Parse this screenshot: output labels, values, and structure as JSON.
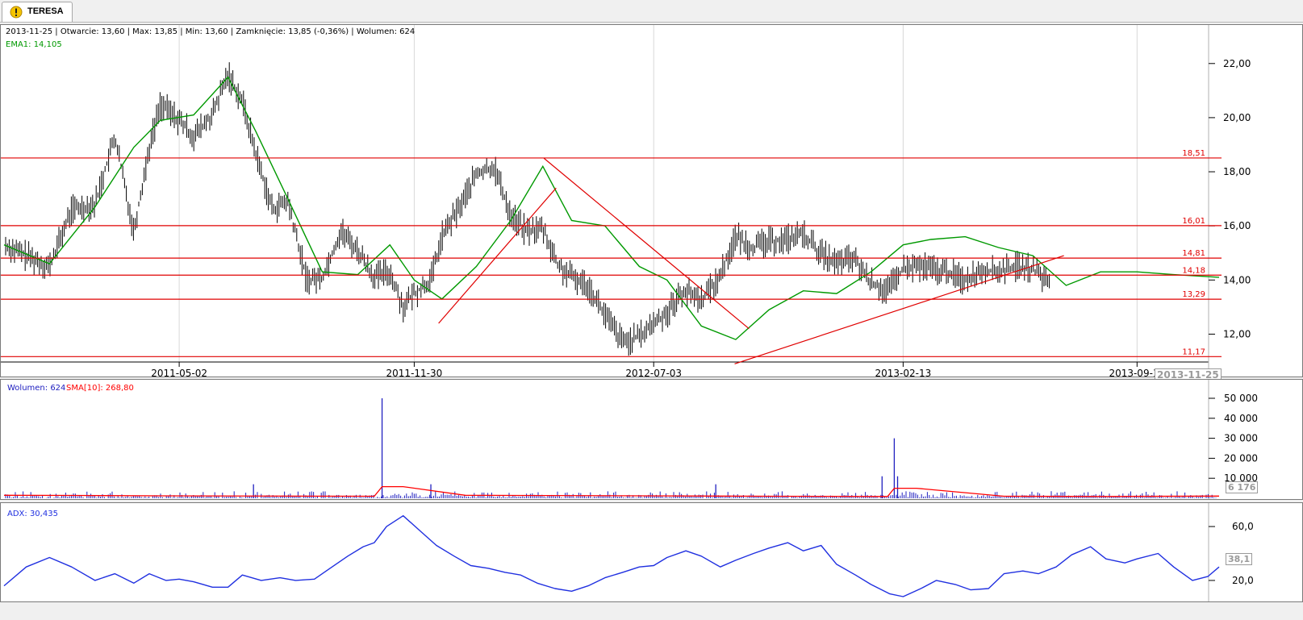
{
  "tab": {
    "label": "TERESA",
    "icon": "warning-icon"
  },
  "price_panel": {
    "info_line": "2013-11-25 | Otwarcie: 13,60 | Max: 13,85 | Min: 13,60 | Zamknięcie: 13,85 (-0,36%)  | Wolumen: 624",
    "ema_label": "EMA1: 14,105",
    "current_date_badge": "2013-11-25"
  },
  "volume_panel": {
    "volume_label": "Wolumen: 624",
    "sma_label": "SMA[10]: 268,80",
    "last_value_badge": "6 176"
  },
  "adx_panel": {
    "adx_label": "ADX: 30,435",
    "last_value_badge": "38,1"
  },
  "colors": {
    "ohlc": "#000000",
    "ema": "#009900",
    "levels": "#e00000",
    "volume": "#2020c0",
    "sma": "#ff0000",
    "adx": "#2030e0"
  },
  "chart_data": [
    {
      "type": "ohlc",
      "title": "TERESA",
      "x_tick_labels": [
        "2011-05-02",
        "2011-11-30",
        "2012-07-03",
        "2013-02-13",
        "2013-09-12"
      ],
      "y_tick_labels": [
        "12,00",
        "14,00",
        "16,00",
        "18,00",
        "20,00",
        "22,00"
      ],
      "ylim": [
        11.0,
        22.5
      ],
      "horizontal_levels": [
        {
          "label": "18,51",
          "value": 18.51
        },
        {
          "label": "16,01",
          "value": 16.01
        },
        {
          "label": "14,81",
          "value": 14.81
        },
        {
          "label": "14,18",
          "value": 14.18
        },
        {
          "label": "13,29",
          "value": 13.29
        },
        {
          "label": "11,17",
          "value": 11.17
        }
      ],
      "trend_lines": [
        {
          "from": [
            "2011-12-22",
            12.4
          ],
          "to": [
            "2012-04-06",
            17.4
          ]
        },
        {
          "from": [
            "2012-03-26",
            18.5
          ],
          "to": [
            "2012-09-27",
            12.2
          ]
        },
        {
          "from": [
            "2012-09-14",
            10.9
          ],
          "to": [
            "2013-07-08",
            14.9
          ]
        }
      ],
      "close_series": {
        "name": "close",
        "x": [
          "2010-11-25",
          "2010-12-15",
          "2011-01-05",
          "2011-01-25",
          "2011-02-15",
          "2011-03-05",
          "2011-03-22",
          "2011-04-05",
          "2011-04-15",
          "2011-05-02",
          "2011-05-15",
          "2011-06-01",
          "2011-06-15",
          "2011-06-28",
          "2011-07-10",
          "2011-07-25",
          "2011-08-08",
          "2011-08-25",
          "2011-09-08",
          "2011-09-25",
          "2011-10-10",
          "2011-10-25",
          "2011-11-08",
          "2011-11-20",
          "2011-11-30",
          "2011-12-15",
          "2011-12-25",
          "2012-01-10",
          "2012-01-25",
          "2012-02-10",
          "2012-02-25",
          "2012-03-10",
          "2012-03-25",
          "2012-04-08",
          "2012-04-20",
          "2012-05-05",
          "2012-05-20",
          "2012-06-05",
          "2012-06-20",
          "2012-07-03",
          "2012-07-15",
          "2012-07-30",
          "2012-08-15",
          "2012-08-30",
          "2012-09-15",
          "2012-09-30",
          "2012-10-15",
          "2012-10-30",
          "2012-11-15",
          "2012-11-30",
          "2012-12-15",
          "2012-12-30",
          "2013-01-15",
          "2013-01-30",
          "2013-02-13",
          "2013-02-25",
          "2013-03-10",
          "2013-03-25",
          "2013-04-10",
          "2013-04-25",
          "2013-05-10",
          "2013-05-25",
          "2013-06-10",
          "2013-06-25",
          "2013-07-10",
          "2013-07-25",
          "2013-08-10",
          "2013-08-25",
          "2013-09-12",
          "2013-09-30",
          "2013-10-15",
          "2013-10-30",
          "2013-11-15",
          "2013-11-25"
        ],
        "y": [
          15.3,
          14.9,
          14.5,
          16.6,
          16.8,
          19.3,
          15.8,
          18.9,
          20.5,
          19.9,
          19.3,
          20.1,
          21.6,
          20.6,
          18.7,
          16.6,
          16.9,
          14.0,
          14.1,
          15.8,
          15.1,
          14.1,
          14.3,
          13.0,
          13.5,
          14.0,
          15.6,
          16.7,
          17.9,
          18.2,
          16.4,
          15.8,
          15.9,
          14.5,
          14.1,
          13.8,
          12.7,
          11.7,
          11.9,
          12.4,
          12.8,
          13.6,
          13.3,
          14.0,
          15.6,
          15.2,
          15.4,
          15.5,
          15.7,
          15.0,
          14.6,
          14.8,
          13.9,
          13.6,
          14.4,
          14.5,
          14.4,
          14.3,
          14.0,
          14.4,
          14.3,
          14.5,
          14.4,
          13.9
        ]
      },
      "ema_series": {
        "name": "EMA1",
        "x": [
          "2010-11-25",
          "2011-01-05",
          "2011-02-15",
          "2011-03-22",
          "2011-04-15",
          "2011-05-15",
          "2011-06-15",
          "2011-07-10",
          "2011-08-08",
          "2011-09-08",
          "2011-10-10",
          "2011-11-08",
          "2011-11-30",
          "2011-12-25",
          "2012-01-25",
          "2012-02-25",
          "2012-03-25",
          "2012-04-20",
          "2012-05-20",
          "2012-06-20",
          "2012-07-15",
          "2012-08-15",
          "2012-09-15",
          "2012-10-15",
          "2012-11-15",
          "2012-12-15",
          "2013-01-15",
          "2013-02-13",
          "2013-03-10",
          "2013-04-10",
          "2013-05-10",
          "2013-06-10",
          "2013-07-10",
          "2013-08-10",
          "2013-09-12",
          "2013-10-15",
          "2013-11-25"
        ],
        "y": [
          15.3,
          14.6,
          16.7,
          18.9,
          19.9,
          20.1,
          21.5,
          19.5,
          17.0,
          14.3,
          14.2,
          15.3,
          14.0,
          13.3,
          14.5,
          16.2,
          18.2,
          16.2,
          16.0,
          14.5,
          14.0,
          12.3,
          11.8,
          12.9,
          13.6,
          13.5,
          14.3,
          15.3,
          15.5,
          15.6,
          15.2,
          14.9,
          13.8,
          14.3,
          14.3,
          14.2,
          14.1
        ]
      }
    },
    {
      "type": "bar",
      "series": [
        {
          "name": "Wolumen",
          "x": [
            "2011-07-08",
            "2011-11-01",
            "2011-12-15",
            "2012-08-28",
            "2013-01-25",
            "2013-02-05",
            "2013-02-08"
          ],
          "values": [
            7000,
            50000,
            7000,
            7000,
            11000,
            30000,
            11000
          ]
        },
        {
          "name": "SMA[10]",
          "x": [
            "2010-11-25",
            "2011-01-25",
            "2011-04-15",
            "2011-10-25",
            "2011-11-01",
            "2011-11-20",
            "2012-01-15",
            "2012-06-20",
            "2012-10-15",
            "2013-01-30",
            "2013-02-05",
            "2013-02-25",
            "2013-05-15",
            "2013-08-15",
            "2013-11-25"
          ],
          "values": [
            1500,
            1400,
            1200,
            1000,
            5800,
            5800,
            1500,
            1200,
            1000,
            900,
            5000,
            5000,
            1000,
            900,
            1100
          ]
        }
      ],
      "y_tick_labels": [
        "10 000",
        "20 000",
        "30 000",
        "40 000",
        "50 000"
      ],
      "ylim": [
        0,
        50000
      ]
    },
    {
      "type": "line",
      "series": [
        {
          "name": "ADX",
          "x": [
            "2010-11-25",
            "2010-12-15",
            "2011-01-05",
            "2011-01-25",
            "2011-02-15",
            "2011-03-05",
            "2011-03-22",
            "2011-04-05",
            "2011-04-20",
            "2011-05-02",
            "2011-05-15",
            "2011-06-01",
            "2011-06-15",
            "2011-06-28",
            "2011-07-15",
            "2011-08-01",
            "2011-08-15",
            "2011-09-01",
            "2011-09-15",
            "2011-10-01",
            "2011-10-15",
            "2011-10-25",
            "2011-11-05",
            "2011-11-20",
            "2011-12-05",
            "2011-12-20",
            "2012-01-05",
            "2012-01-20",
            "2012-02-05",
            "2012-02-20",
            "2012-03-05",
            "2012-03-20",
            "2012-04-05",
            "2012-04-20",
            "2012-05-05",
            "2012-05-20",
            "2012-06-05",
            "2012-06-20",
            "2012-07-03",
            "2012-07-15",
            "2012-08-01",
            "2012-08-15",
            "2012-09-01",
            "2012-09-15",
            "2012-10-01",
            "2012-10-15",
            "2012-11-01",
            "2012-11-15",
            "2012-12-01",
            "2012-12-15",
            "2013-01-01",
            "2013-01-15",
            "2013-02-01",
            "2013-02-13",
            "2013-03-01",
            "2013-03-15",
            "2013-04-01",
            "2013-04-15",
            "2013-05-01",
            "2013-05-15",
            "2013-06-01",
            "2013-06-15",
            "2013-07-01",
            "2013-07-15",
            "2013-08-01",
            "2013-08-15",
            "2013-09-01",
            "2013-09-12",
            "2013-10-01",
            "2013-10-15",
            "2013-11-01",
            "2013-11-15",
            "2013-11-25"
          ],
          "values": [
            16,
            30,
            37,
            30,
            20,
            25,
            18,
            25,
            20,
            21,
            19,
            15,
            15,
            24,
            20,
            22,
            20,
            21,
            29,
            38,
            45,
            48,
            60,
            68,
            57,
            46,
            38,
            31,
            29,
            26,
            24,
            18,
            14,
            12,
            16,
            22,
            26,
            30,
            31,
            37,
            42,
            38,
            30,
            35,
            40,
            44,
            48,
            42,
            46,
            32,
            24,
            17,
            10,
            8,
            14,
            20,
            17,
            13,
            14,
            25,
            27,
            25,
            30,
            39,
            45,
            36,
            33,
            36,
            40,
            30,
            20,
            23,
            30
          ]
        }
      ],
      "y_tick_labels": [
        "20,0",
        "60,0"
      ],
      "ylim": [
        5,
        75
      ]
    }
  ]
}
